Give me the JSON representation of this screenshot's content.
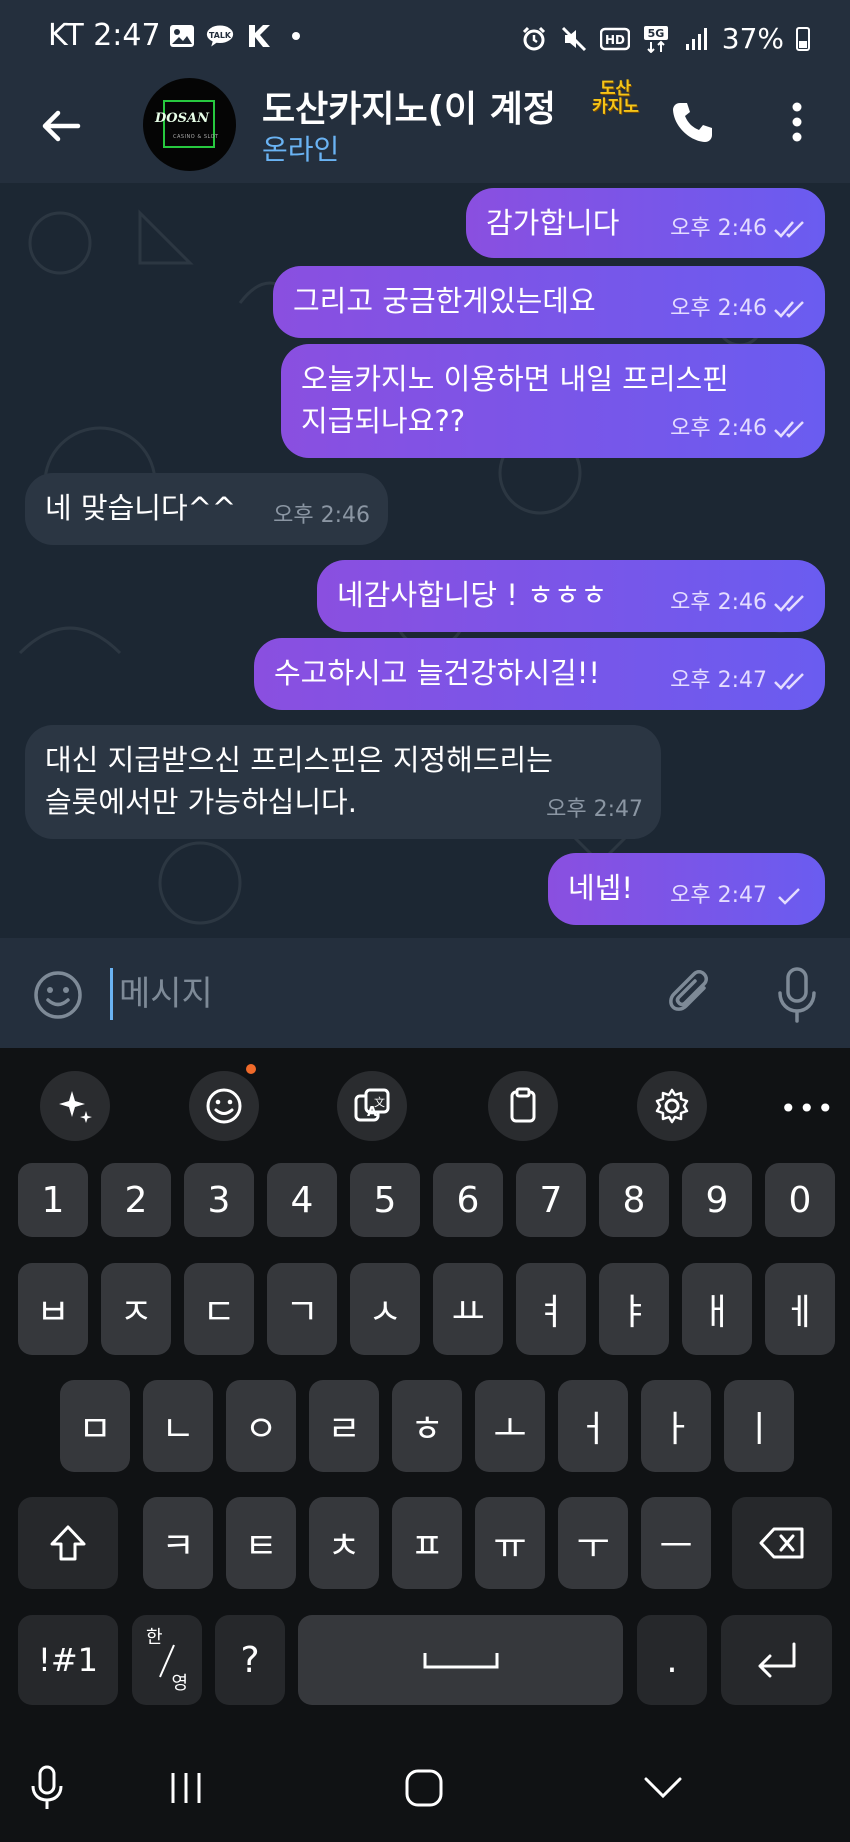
{
  "status_bar": {
    "carrier_time": "KT 2:47",
    "network": "5G",
    "hd_label": "HD",
    "battery": "37%",
    "icons": [
      "image-icon",
      "kakaotalk-icon",
      "k-app-icon",
      "dot-icon",
      "alarm-icon",
      "mute-icon",
      "hd-icon",
      "5g-icon",
      "signal-icon",
      "battery-icon"
    ]
  },
  "header": {
    "title": "도산카지노(이 계정",
    "badge_line1": "도산",
    "badge_line2": "카지노",
    "status": "온라인",
    "avatar_logo": "DOSAN",
    "avatar_sub": "CASINO & SLOT"
  },
  "messages": [
    {
      "direction": "out",
      "text": "감가합니다",
      "time": "오후 2:46",
      "read": true
    },
    {
      "direction": "out",
      "text": "그리고 궁금한게있는데요",
      "time": "오후 2:46",
      "read": true
    },
    {
      "direction": "out",
      "text": "오늘카지노 이용하면 내일 프리스핀\n지급되나요??",
      "time": "오후 2:46",
      "read": true
    },
    {
      "direction": "in",
      "text": "네 맞습니다^^",
      "time": "오후 2:46"
    },
    {
      "direction": "out",
      "text": "네감사합니당 ! ㅎㅎㅎ",
      "time": "오후 2:46",
      "read": true
    },
    {
      "direction": "out",
      "text": "수고하시고 늘건강하시길!!",
      "time": "오후 2:47",
      "read": true
    },
    {
      "direction": "in",
      "text": "대신 지급받으신 프리스핀은 지정해드리는\n슬롯에서만 가능하십니다.",
      "time": "오후 2:47"
    },
    {
      "direction": "out",
      "text": "네넵!",
      "time": "오후 2:47",
      "read": false
    }
  ],
  "input": {
    "placeholder": "메시지",
    "value": ""
  },
  "keyboard": {
    "number_row": [
      "1",
      "2",
      "3",
      "4",
      "5",
      "6",
      "7",
      "8",
      "9",
      "0"
    ],
    "row1": [
      "ㅂ",
      "ㅈ",
      "ㄷ",
      "ㄱ",
      "ㅅ",
      "ㅛ",
      "ㅕ",
      "ㅑ",
      "ㅐ",
      "ㅔ"
    ],
    "row2": [
      "ㅁ",
      "ㄴ",
      "ㅇ",
      "ㄹ",
      "ㅎ",
      "ㅗ",
      "ㅓ",
      "ㅏ",
      "ㅣ"
    ],
    "row3": [
      "ㅋ",
      "ㅌ",
      "ㅊ",
      "ㅍ",
      "ㅠ",
      "ㅜ",
      "ㅡ"
    ],
    "symbols_label": "!#1",
    "lang_top": "한",
    "lang_bottom": "영",
    "question_label": "?",
    "period_label": "."
  },
  "colors": {
    "outgoing_bubble": "#7b55e6",
    "incoming_bubble": "#2b3643",
    "header_bg": "#242f3d",
    "chat_bg": "#1c2733",
    "online_status": "#6ab3f3"
  }
}
